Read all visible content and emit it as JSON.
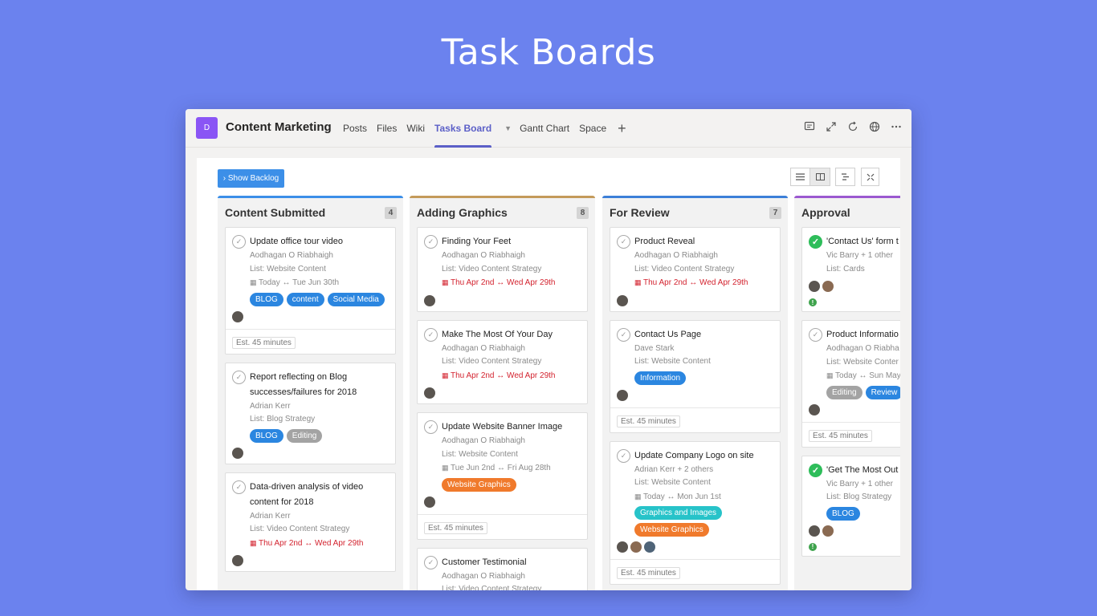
{
  "hero_title": "Task Boards",
  "app": {
    "avatar_letter": "D",
    "title": "Content Marketing"
  },
  "nav": {
    "tabs": [
      "Posts",
      "Files",
      "Wiki",
      "Tasks Board",
      "Gantt Chart",
      "Space"
    ],
    "active_index": 3,
    "add_label": "+"
  },
  "top_icons": [
    "chat-icon",
    "expand-icon",
    "refresh-icon",
    "globe-icon",
    "more-icon"
  ],
  "toolbar": {
    "backlog_label": "› Show Backlog",
    "view_modes": [
      "list-view",
      "board-view",
      "gantt-view"
    ],
    "selected_view": "board-view"
  },
  "colors": {
    "Content Submitted": "#3c8fe8",
    "Adding Graphics": "#c49a5a",
    "For Review": "#3c7fd8",
    "Approval": "#9b59d0",
    "BLOG": "#2b86e0",
    "content": "#2b86e0",
    "Social Media": "#2b86e0",
    "Editing": "#a3a3a3",
    "Website Graphics": "#f07a2c",
    "Information": "#2b86e0",
    "Graphics and Images": "#27c3c9",
    "Review": "#2b86e0"
  },
  "columns": [
    {
      "title": "Content Submitted",
      "count": "4",
      "cards": [
        {
          "title": "Update office tour video",
          "assignee": "Aodhagan O Riabhaigh",
          "list": "List: Website Content",
          "date": "Today ↔ Tue Jun 30th",
          "date_overdue": false,
          "tags": [
            "BLOG",
            "content",
            "Social Media"
          ],
          "avatars": 1,
          "estimate": "Est. 45 minutes"
        },
        {
          "title": "Report reflecting on Blog successes/failures for 2018",
          "assignee": "Adrian Kerr",
          "list": "List: Blog Strategy",
          "tags": [
            "BLOG",
            "Editing"
          ],
          "avatars": 1
        },
        {
          "title": "Data-driven analysis of video content for 2018",
          "assignee": "Adrian Kerr",
          "list": "List: Video Content Strategy",
          "date": "Thu Apr 2nd ↔ Wed Apr 29th",
          "date_overdue": true,
          "avatars": 1
        }
      ]
    },
    {
      "title": "Adding Graphics",
      "count": "8",
      "cards": [
        {
          "title": "Finding Your Feet",
          "assignee": "Aodhagan O Riabhaigh",
          "list": "List: Video Content Strategy",
          "date": "Thu Apr 2nd ↔ Wed Apr 29th",
          "date_overdue": true,
          "avatars": 1
        },
        {
          "title": "Make The Most Of Your Day",
          "assignee": "Aodhagan O Riabhaigh",
          "list": "List: Video Content Strategy",
          "date": "Thu Apr 2nd ↔ Wed Apr 29th",
          "date_overdue": true,
          "avatars": 1
        },
        {
          "title": "Update Website Banner Image",
          "assignee": "Aodhagan O Riabhaigh",
          "list": "List: Website Content",
          "date": "Tue Jun 2nd ↔ Fri Aug 28th",
          "date_overdue": false,
          "tags": [
            "Website Graphics"
          ],
          "avatars": 1,
          "estimate": "Est. 45 minutes"
        },
        {
          "title": "Customer Testimonial",
          "assignee": "Aodhagan O Riabhaigh",
          "list": "List: Video Content Strategy"
        }
      ]
    },
    {
      "title": "For Review",
      "count": "7",
      "cards": [
        {
          "title": "Product Reveal",
          "assignee": "Aodhagan O Riabhaigh",
          "list": "List: Video Content Strategy",
          "date": "Thu Apr 2nd ↔ Wed Apr 29th",
          "date_overdue": true,
          "avatars": 1
        },
        {
          "title": "Contact Us Page",
          "assignee": "Dave Stark",
          "list": "List: Website Content",
          "tags": [
            "Information"
          ],
          "avatars": 1,
          "estimate": "Est. 45 minutes"
        },
        {
          "title": "Update Company Logo on site",
          "assignee": "Adrian Kerr + 2 others",
          "list": "List: Website Content",
          "date": "Today ↔ Mon Jun 1st",
          "date_overdue": false,
          "tags": [
            "Graphics and Images",
            "Website Graphics"
          ],
          "avatars": 3,
          "estimate": "Est. 45 minutes"
        }
      ]
    },
    {
      "title": "Approval",
      "count": "",
      "cards": [
        {
          "title": "'Contact Us' form t",
          "done": true,
          "assignee": "Vic Barry + 1 other",
          "list": "List: Cards",
          "avatars": 2,
          "flag": true
        },
        {
          "title": "Product Informatio",
          "assignee": "Aodhagan O Riabha",
          "list": "List: Website Conter",
          "date": "Today ↔ Sun May",
          "date_overdue": false,
          "tags": [
            "Editing",
            "Review"
          ],
          "avatars": 1,
          "estimate": "Est. 45 minutes"
        },
        {
          "title": "'Get The Most Out Medium post",
          "done": true,
          "assignee": "Vic Barry + 1 other",
          "list": "List: Blog Strategy",
          "tags": [
            "BLOG"
          ],
          "avatars": 2,
          "flag": true
        }
      ]
    }
  ]
}
